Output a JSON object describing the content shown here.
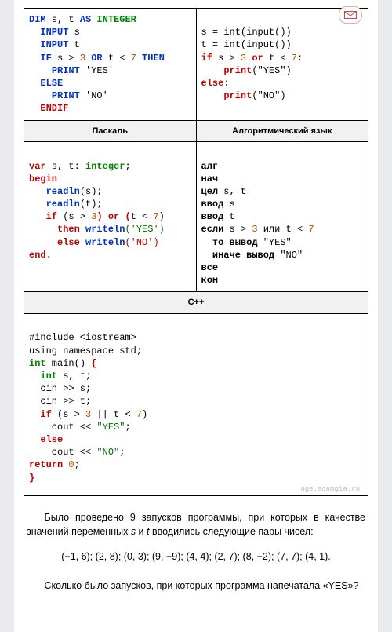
{
  "headers": {
    "pascal": "Паскаль",
    "algo": "Алгоритмический язык",
    "cpp": "C++"
  },
  "basic": {
    "dim": "DIM",
    "sT": " s, t ",
    "as": "AS",
    "integer": " INTEGER",
    "input1": "INPUT",
    "input1v": " s",
    "input2": "INPUT",
    "input2v": " t",
    "if": "IF",
    "cond1": " s > ",
    "n3": "3",
    "or": " OR ",
    "cond2": "t < ",
    "n7": "7",
    "then": " THEN",
    "print1": "PRINT",
    "yes": " 'YES'",
    "else": "ELSE",
    "print2": "PRINT",
    "no": " 'NO'",
    "endif": "ENDIF"
  },
  "python": {
    "l1a": "s = ",
    "l1b": "int",
    "l1c": "(",
    "l1d": "input",
    "l1e": "())",
    "l2a": "t = ",
    "l2b": "int",
    "l2c": "(",
    "l2d": "input",
    "l2e": "())",
    "ifk": "if",
    "cond1": " s > ",
    "n3": "3",
    "ork": " or ",
    "cond2": "t < ",
    "n7": "7",
    "colon": ":",
    "print1": "print",
    "yes": "(\"YES\")",
    "elsek": "else",
    "colon2": ":",
    "print2": "print",
    "no": "(\"NO\")"
  },
  "pascal": {
    "var": "var",
    "st": " s, t: ",
    "integer": "integer",
    "semi": ";",
    "begin": "begin",
    "readln1": "readln",
    "r1arg": "(s);",
    "readln2": "readln",
    "r2arg": "(t);",
    "if": "if",
    "cond": " (s > ",
    "n3": "3",
    "or": ") or (",
    "cond2": "t < ",
    "n7": "7",
    "close": ")",
    "then": "then ",
    "writeln1": "writeln",
    "yes": "('YES')",
    "else": "else ",
    "writeln2": "writeln",
    "no": "('NO')",
    "end": "end."
  },
  "algo": {
    "l1": "алг",
    "l2": "нач",
    "l3a": "цел",
    "l3b": " s, t",
    "l4a": "ввод",
    "l4b": " s",
    "l5a": "ввод",
    "l5b": " t",
    "l6a": "если",
    "l6b": " s > ",
    "n3": "3",
    "l6c": " или ",
    "l6d": "t < ",
    "n7": "7",
    "l7a": "то вывод",
    "l7b": " \"YES\"",
    "l8a": "иначе вывод",
    "l8b": " \"NO\"",
    "l9": "все",
    "l10": "кон"
  },
  "cpp": {
    "inc": "#include <iostream>",
    "ns": "using namespace std;",
    "intk": "int",
    "main": " main() ",
    "ob": "{",
    "intk2": "int",
    "st": " s, t;",
    "cin1": "  cin >> s;",
    "cin2": "  cin >> t;",
    "ifk": "if",
    "cond": " (s > ",
    "n3": "3",
    "or": " || t < ",
    "n7": "7",
    "close": ")",
    "cout1a": "    cout << ",
    "yes": "\"YES\"",
    "semi1": ";",
    "elsek": "else",
    "cout2a": "    cout << ",
    "no": "\"NO\"",
    "semi2": ";",
    "ret": "return",
    "zero": " 0",
    "semi3": ";",
    "cb": "}"
  },
  "watermark": "oge.sdamgia.ru",
  "para1a": "Было проведено 9 запусков программы, при кото­рых в качестве значений переменных ",
  "para1_s": "s",
  "para1b": " и ",
  "para1_t": "t",
  "para1c": " вводились следующие пары чисел:",
  "pairs": "(−1, 6); (2, 8); (0, 3); (9, −9); (4, 4); (2, 7); (8, −2); (7, 7); (4, 1).",
  "para2": "Сколько было запусков, при которых программа напечатала «YES»?"
}
